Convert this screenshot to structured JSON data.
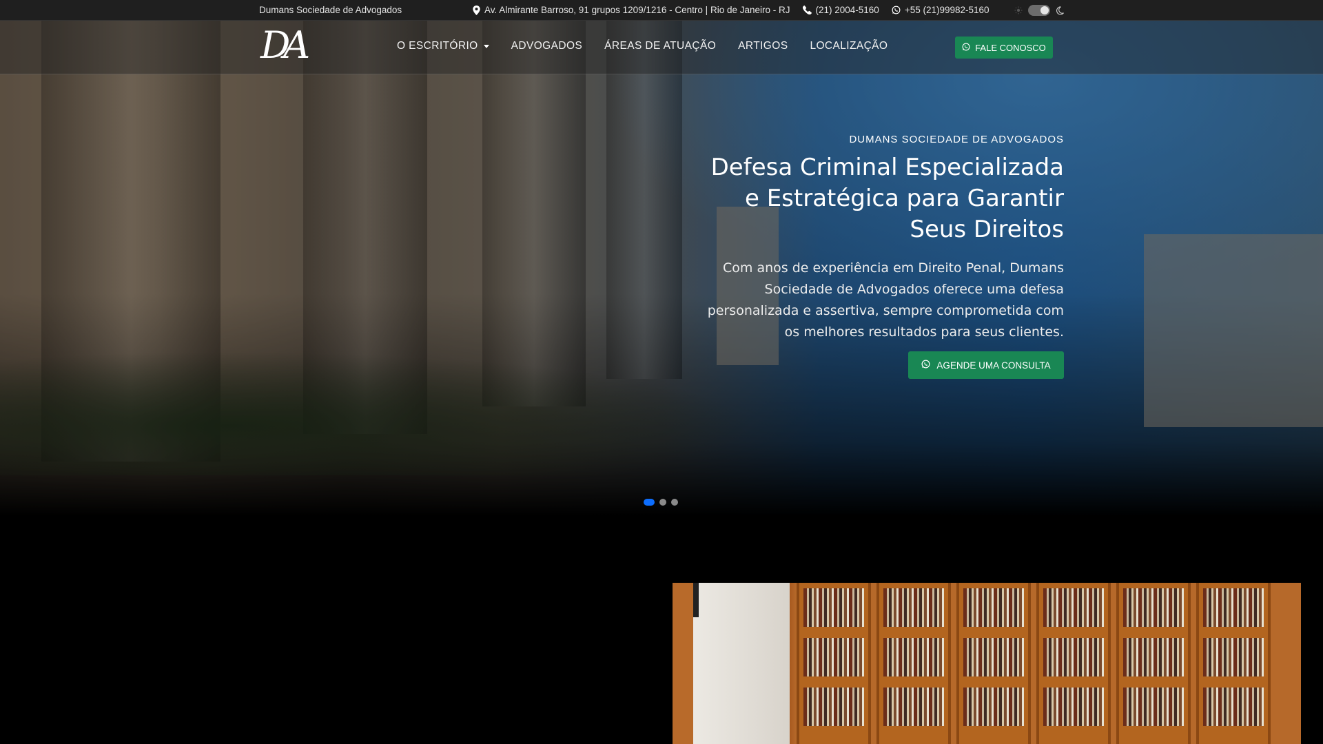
{
  "topbar": {
    "brand": "Dumans Sociedade de Advogados",
    "address": "Av. Almirante Barroso, 91 grupos 1209/1216 - Centro | Rio de Janeiro - RJ",
    "phone": "(21) 2004-5160",
    "whatsapp": "+55 (21)99982-5160"
  },
  "navbar": {
    "logo": "DA",
    "items": [
      {
        "label": "O ESCRITÓRIO",
        "dropdown": true
      },
      {
        "label": "ADVOGADOS"
      },
      {
        "label": "ÁREAS DE ATUAÇÃO"
      },
      {
        "label": "ARTIGOS"
      },
      {
        "label": "LOCALIZAÇÃO"
      }
    ],
    "cta_label": "FALE CONOSCO"
  },
  "hero": {
    "eyebrow": "DUMANS SOCIEDADE DE ADVOGADOS",
    "headline": "Defesa Criminal Especializada e Estratégica para Garantir Seus Direitos",
    "lead": "Com anos de experiência em Direito Penal, Dumans Sociedade de Advogados oferece uma defesa personalizada e assertiva, sempre comprometida com os melhores resultados para seus clientes.",
    "button_label": "AGENDE UMA CONSULTA",
    "slides_total": 3,
    "active_slide": 1
  },
  "colors": {
    "accent_green": "#198754",
    "indicator_active": "#0d6efd"
  },
  "icons": [
    "map-pin-icon",
    "phone-icon",
    "whatsapp-icon",
    "sun-icon",
    "moon-icon"
  ]
}
